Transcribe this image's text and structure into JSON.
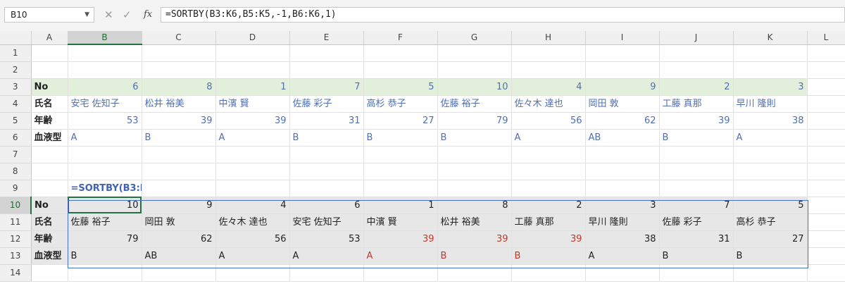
{
  "formula_bar": {
    "name_box": "B10",
    "dropdown_icon": "chevron-down-icon",
    "cancel_icon": "close-icon",
    "enter_icon": "check-icon",
    "fx_label": "fx",
    "formula": "=SORTBY(B3:K6,B5:K5,-1,B6:K6,1)"
  },
  "columns": [
    "A",
    "B",
    "C",
    "D",
    "E",
    "F",
    "G",
    "H",
    "I",
    "J",
    "K",
    "L"
  ],
  "rows": [
    "1",
    "2",
    "3",
    "4",
    "5",
    "6",
    "7",
    "8",
    "9",
    "10",
    "11",
    "12",
    "13",
    "14"
  ],
  "source": {
    "labels": {
      "no": "No",
      "name": "氏名",
      "age": "年齢",
      "blood": "血液型"
    },
    "no": [
      "6",
      "8",
      "1",
      "7",
      "5",
      "10",
      "4",
      "9",
      "2",
      "3"
    ],
    "name": [
      "安宅 佐知子",
      "松井 裕美",
      "中濱 賢",
      "佐藤 彩子",
      "高杉 恭子",
      "佐藤 裕子",
      "佐々木 達也",
      "岡田 敦",
      "工藤 真那",
      "早川 隆則"
    ],
    "age": [
      "53",
      "39",
      "39",
      "31",
      "27",
      "79",
      "56",
      "62",
      "39",
      "38"
    ],
    "blood": [
      "A",
      "B",
      "A",
      "B",
      "B",
      "B",
      "A",
      "AB",
      "B",
      "A"
    ]
  },
  "formula_display": "=SORTBY(B3:K6,B5:K5,-1,B6:K6,1)",
  "result": {
    "labels": {
      "no": "No",
      "name": "氏名",
      "age": "年齢",
      "blood": "血液型"
    },
    "no": [
      "10",
      "9",
      "4",
      "6",
      "1",
      "8",
      "2",
      "3",
      "7",
      "5"
    ],
    "name": [
      "佐藤 裕子",
      "岡田 敦",
      "佐々木 達也",
      "安宅 佐知子",
      "中濱 賢",
      "松井 裕美",
      "工藤 真那",
      "早川 隆則",
      "佐藤 彩子",
      "高杉 恭子"
    ],
    "age": [
      "79",
      "62",
      "56",
      "53",
      "39",
      "39",
      "39",
      "38",
      "31",
      "27"
    ],
    "blood": [
      "B",
      "AB",
      "A",
      "A",
      "A",
      "B",
      "B",
      "A",
      "B",
      "B"
    ]
  },
  "colors": {
    "accent": "#217346",
    "source_text": "#4f6fb4",
    "highlight_red": "#c0392b",
    "source_fill": "#e2efda",
    "result_fill": "#e7e7e7"
  }
}
